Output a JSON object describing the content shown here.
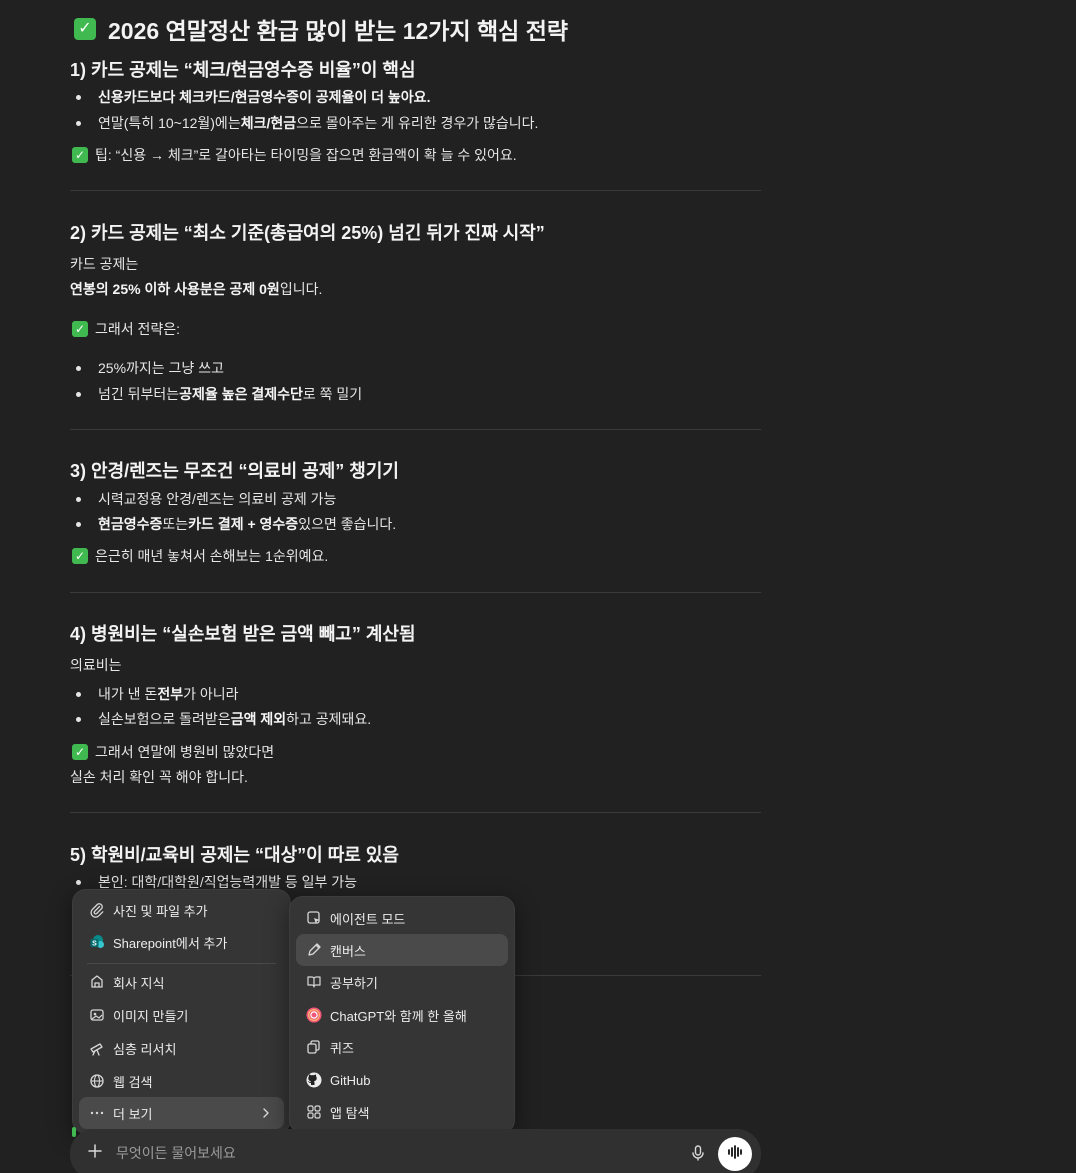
{
  "article": {
    "title": "2026 연말정산 환급 많이 받는 12가지 핵심 전략",
    "s1": {
      "heading": "1) 카드 공제는 “체크/현금영수증 비율”이 핵심",
      "b1": "신용카드보다 체크카드/현금영수증이 공제율이 더 높아요.",
      "b2_pre": "연말(특히 10~12월)에는 ",
      "b2_bold": "체크/현금",
      "b2_post": "으로 몰아주는 게 유리한 경우가 많습니다.",
      "tip": "팁: “신용 → 체크”로 갈아타는 타이밍을 잡으면 환급액이 확 늘 수 있어요."
    },
    "s2": {
      "heading": "2) 카드 공제는 “최소 기준(총급여의 25%) 넘긴 뒤가 진짜 시작”",
      "p1": "카드 공제는",
      "p2_bold": "연봉의 25% 이하 사용분은 공제 0원",
      "p2_post": "입니다.",
      "tip": "그래서 전략은:",
      "b1": "25%까지는 그냥 쓰고",
      "b2_pre": "넘긴 뒤부터는 ",
      "b2_bold": "공제율 높은 결제수단",
      "b2_post": "로 쭉 밀기"
    },
    "s3": {
      "heading": "3) 안경/렌즈는 무조건 “의료비 공제” 챙기기",
      "b1": "시력교정용 안경/렌즈는 의료비 공제 가능",
      "b2_bold1": "현금영수증",
      "b2_mid": " 또는 ",
      "b2_bold2": "카드 결제 + 영수증",
      "b2_post": " 있으면 좋습니다.",
      "tip": "은근히 매년 놓쳐서 손해보는 1순위예요."
    },
    "s4": {
      "heading": "4) 병원비는 “실손보험 받은 금액 빼고” 계산됨",
      "p1": "의료비는",
      "b1_pre": "내가 낸 돈 ",
      "b1_bold": "전부",
      "b1_post": "가 아니라",
      "b2_pre": "실손보험으로 돌려받은 ",
      "b2_bold": "금액 제외",
      "b2_post": "하고 공제돼요.",
      "tip": "그래서 연말에 병원비 많았다면",
      "p2": "실손 처리 확인 꼭 해야 합니다."
    },
    "s5": {
      "heading": "5) 학원비/교육비 공제는 “대상”이 따로 있음",
      "b1": "본인: 대학/대학원/직업능력개발 등 일부 가능"
    }
  },
  "menu_left": {
    "items": [
      {
        "label": "사진 및 파일 추가",
        "icon": "paperclip-icon"
      },
      {
        "label": "Sharepoint에서 추가",
        "icon": "sharepoint-icon"
      },
      {
        "label": "회사 지식",
        "icon": "company-knowledge-icon"
      },
      {
        "label": "이미지 만들기",
        "icon": "image-create-icon"
      },
      {
        "label": "심층 리서치",
        "icon": "telescope-icon"
      },
      {
        "label": "웹 검색",
        "icon": "globe-icon"
      },
      {
        "label": "더 보기",
        "icon": "more-dots-icon"
      }
    ]
  },
  "menu_right": {
    "items": [
      {
        "label": "에이전트 모드",
        "icon": "agent-cursor-icon"
      },
      {
        "label": "캔버스",
        "icon": "pen-icon"
      },
      {
        "label": "공부하기",
        "icon": "book-icon"
      },
      {
        "label": "ChatGPT와 함께 한 올해",
        "icon": "year-review-icon"
      },
      {
        "label": "퀴즈",
        "icon": "cards-icon"
      },
      {
        "label": "GitHub",
        "icon": "github-icon"
      },
      {
        "label": "앱 탐색",
        "icon": "apps-grid-icon"
      }
    ]
  },
  "composer": {
    "placeholder": "무엇이든 물어보세요"
  },
  "colors": {
    "background": "#212121",
    "check_green": "#3fb950",
    "menu_bg": "#353535"
  }
}
